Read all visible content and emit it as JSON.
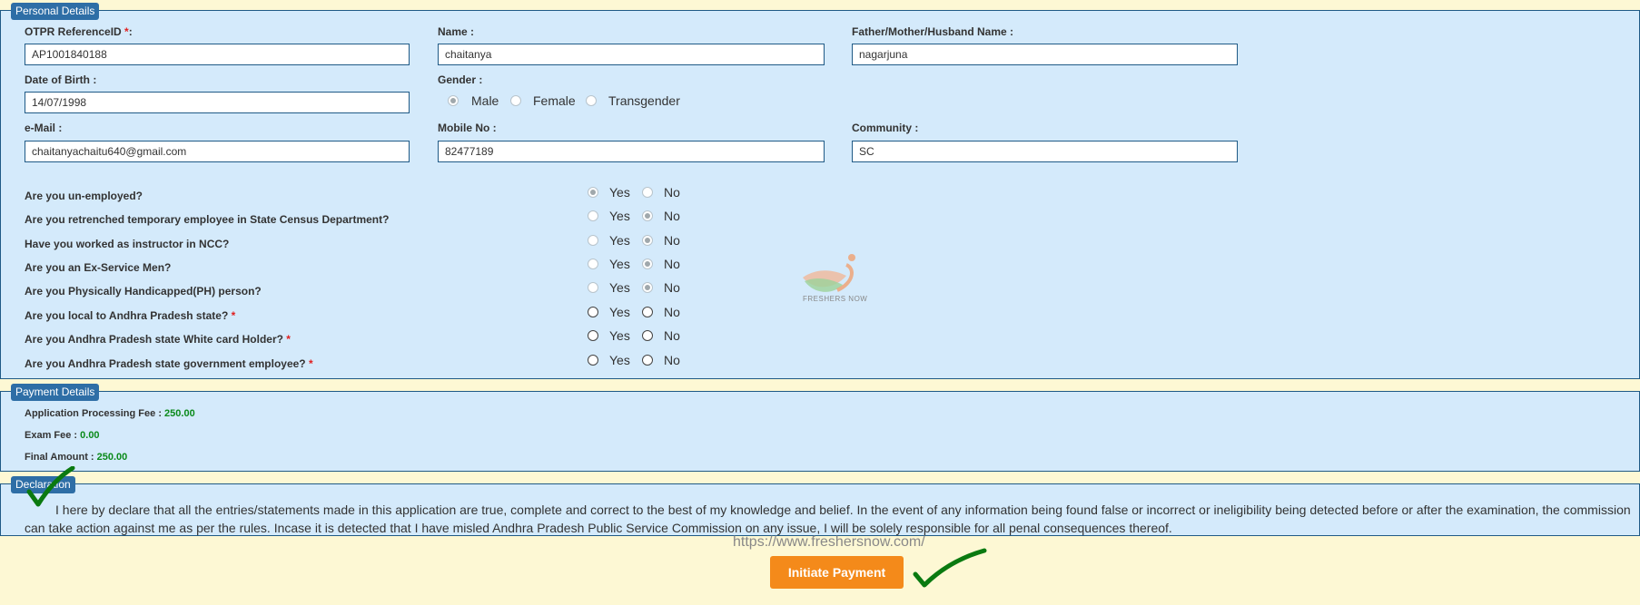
{
  "personal": {
    "legend": "Personal Details",
    "fields": {
      "otpr": {
        "label": "OTPR ReferenceID ",
        "req": "*",
        "colon": ":",
        "value": "AP1001840188"
      },
      "name": {
        "label": "Name :",
        "value": "chaitanya"
      },
      "father": {
        "label": "Father/Mother/Husband Name :",
        "value": "nagarjuna"
      },
      "dob": {
        "label": "Date of Birth :",
        "value": "14/07/1998"
      },
      "gender": {
        "label": "Gender :",
        "options": [
          "Male",
          "Female",
          "Transgender"
        ],
        "selected": "Male"
      },
      "email": {
        "label": "e-Mail :",
        "value": "chaitanyachaitu640@gmail.com"
      },
      "mobile": {
        "label": "Mobile No :",
        "value": "82477189"
      },
      "community": {
        "label": "Community :",
        "value": "SC"
      }
    },
    "questions": [
      {
        "text": "Are you un-employed?",
        "req": "",
        "selected": "Yes"
      },
      {
        "text": "Are you retrenched temporary employee in State Census Department?",
        "req": "",
        "selected": "No"
      },
      {
        "text": "Have you worked as instructor in NCC?",
        "req": "",
        "selected": "No"
      },
      {
        "text": "Are you an Ex-Service Men?",
        "req": "",
        "selected": "No"
      },
      {
        "text": "Are you Physically Handicapped(PH) person?",
        "req": "",
        "selected": "No"
      },
      {
        "text": "Are you local to Andhra Pradesh state?",
        "req": "*",
        "selected": ""
      },
      {
        "text": "Are you Andhra Pradesh state White card Holder?",
        "req": "*",
        "selected": ""
      },
      {
        "text": "Are you Andhra Pradesh state government employee?",
        "req": "*",
        "selected": ""
      }
    ],
    "yes": "Yes",
    "no": "No"
  },
  "payment": {
    "legend": "Payment Details",
    "rows": [
      {
        "label": "Application Processing Fee : ",
        "value": "250.00"
      },
      {
        "label": "Exam Fee : ",
        "value": "0.00"
      },
      {
        "label": "Final Amount : ",
        "value": "250.00"
      }
    ]
  },
  "declaration": {
    "legend": "Declaration",
    "text": "I here by declare that all the entries/statements made in this application are true, complete and correct to the best of my knowledge and belief. In the event of any information being found false or incorrect or ineligibility being detected before or after the examination, the commission can take action against me as per the rules. Incase it is detected that I have misled Andhra Pradesh Public Service Commission on any issue, I will be solely responsible for all penal consequences thereof."
  },
  "watermark": {
    "url": "https://www.freshersnow.com/",
    "logo_text": "FRESHERS NOW"
  },
  "actions": {
    "initiate": "Initiate Payment"
  },
  "colors": {
    "accent": "#2e6ea6",
    "button": "#f48a1a",
    "panel": "#d4eafb",
    "page": "#fdf8d4",
    "check": "#0a7a10"
  }
}
